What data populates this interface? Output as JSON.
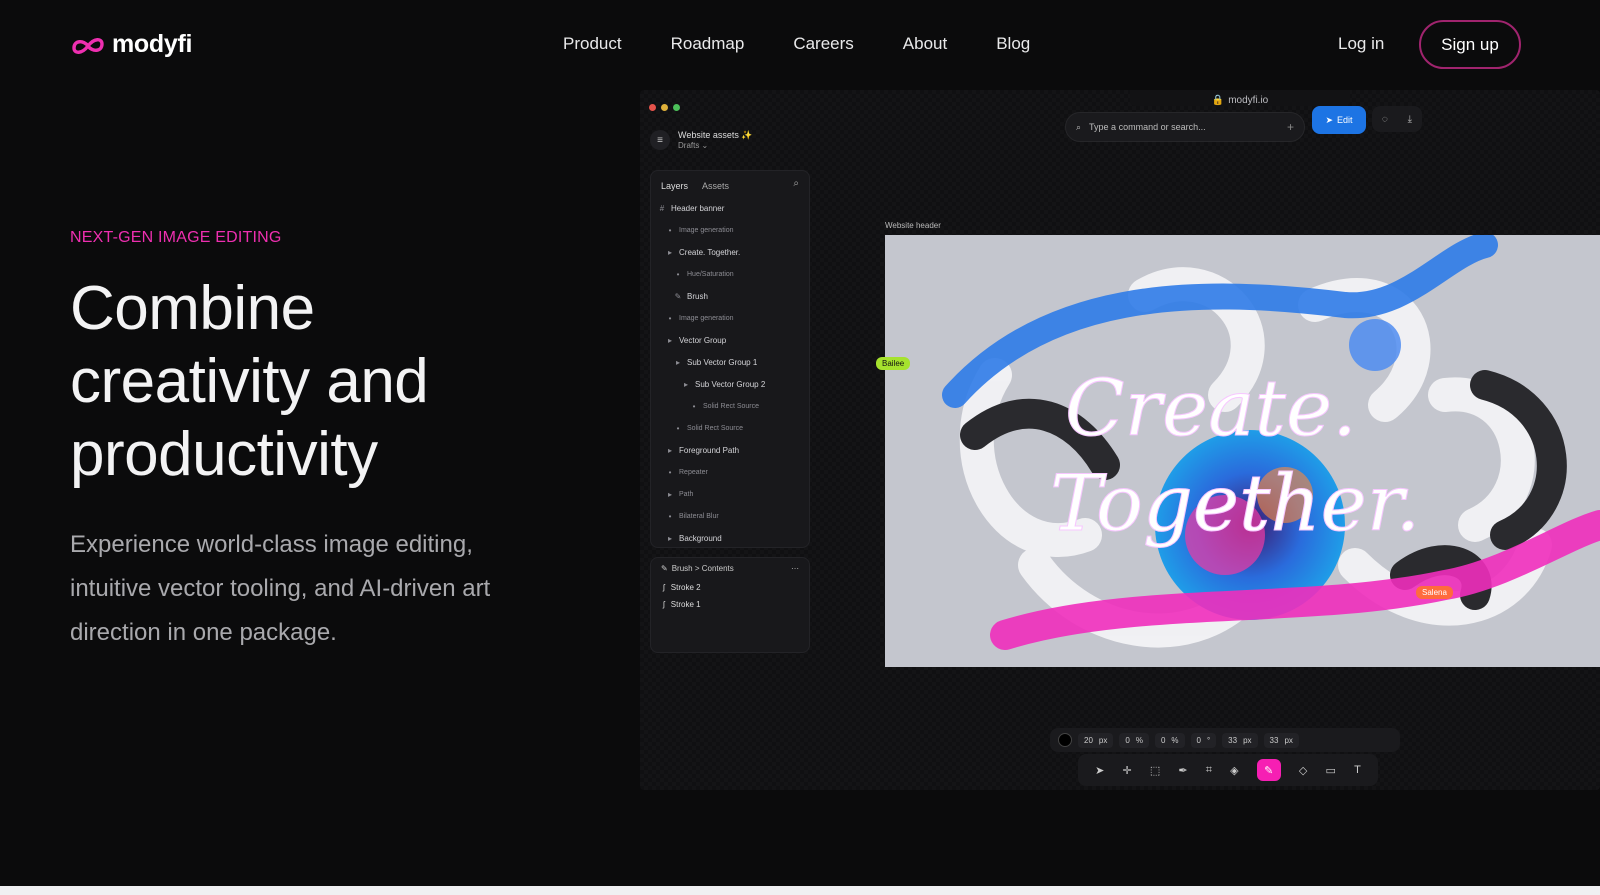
{
  "brand": {
    "name": "modyfi",
    "accent": "#ee2fb0"
  },
  "nav": {
    "links": [
      "Product",
      "Roadmap",
      "Careers",
      "About",
      "Blog"
    ],
    "login": "Log in",
    "signup": "Sign up"
  },
  "hero": {
    "eyebrow": "NEXT-GEN IMAGE EDITING",
    "headline_lines": [
      "Combine",
      "creativity and",
      "productivity"
    ],
    "description": "Experience world-class image editing, intuitive vector tooling, and AI-driven art direction in one package."
  },
  "mock": {
    "url": "modyfi.io",
    "project_title": "Website assets ✨",
    "project_sub": "Drafts ⌄",
    "command_placeholder": "Type a command or search...",
    "edit_label": "Edit",
    "tabs": [
      "Layers",
      "Assets"
    ],
    "layers": [
      {
        "label": "Header banner",
        "dim": false,
        "glyph": "#",
        "indent": 0
      },
      {
        "label": "Image generation",
        "dim": true,
        "glyph": "•",
        "indent": 1
      },
      {
        "label": "Create. Together.",
        "dim": false,
        "glyph": "▸",
        "indent": 1
      },
      {
        "label": "Hue/Saturation",
        "dim": true,
        "glyph": "•",
        "indent": 2
      },
      {
        "label": "Brush",
        "dim": false,
        "glyph": "✎",
        "indent": 2
      },
      {
        "label": "Image generation",
        "dim": true,
        "glyph": "•",
        "indent": 1
      },
      {
        "label": "Vector Group",
        "dim": false,
        "glyph": "▸",
        "indent": 1
      },
      {
        "label": "Sub Vector Group 1",
        "dim": false,
        "glyph": "▸",
        "indent": 2
      },
      {
        "label": "Sub Vector Group 2",
        "dim": false,
        "glyph": "▸",
        "indent": 3
      },
      {
        "label": "Solid Rect Source",
        "dim": true,
        "glyph": "•",
        "indent": 4
      },
      {
        "label": "Solid Rect Source",
        "dim": true,
        "glyph": "•",
        "indent": 2
      },
      {
        "label": "Foreground Path",
        "dim": false,
        "glyph": "▸",
        "indent": 1
      },
      {
        "label": "Repeater",
        "dim": true,
        "glyph": "•",
        "indent": 1
      },
      {
        "label": "Path",
        "dim": true,
        "glyph": "▸",
        "indent": 1
      },
      {
        "label": "Bilateral Blur",
        "dim": true,
        "glyph": "•",
        "indent": 1
      },
      {
        "label": "Background",
        "dim": false,
        "glyph": "▸",
        "indent": 1
      }
    ],
    "brush_panel": {
      "crumb": "Brush > Contents",
      "strokes": [
        "Stroke 2",
        "Stroke 1"
      ]
    },
    "canvas_label": "Website header",
    "artwork_text": [
      "Create.",
      "Together."
    ],
    "cursors": [
      {
        "name": "Bailee",
        "color": "#a6e22e"
      },
      {
        "name": "Salena",
        "color": "#ff6b3d"
      }
    ],
    "toolbar_values": [
      "20",
      "px",
      "0",
      "%",
      "0",
      "%",
      "0",
      "°",
      "33",
      "px",
      "33",
      "px"
    ]
  }
}
